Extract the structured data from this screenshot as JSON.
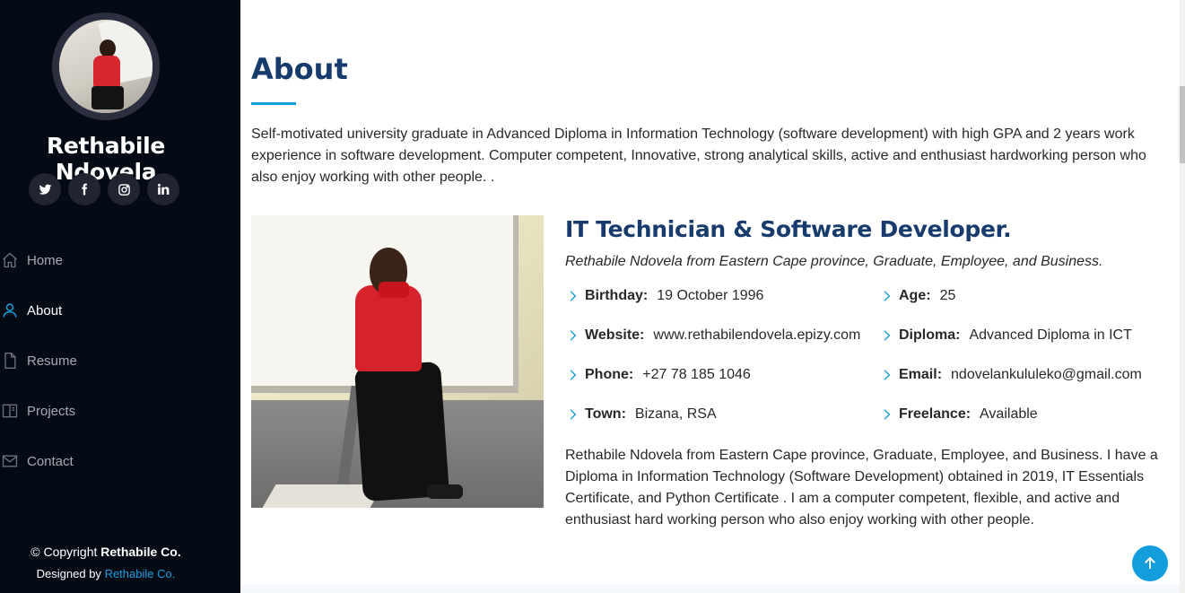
{
  "profile": {
    "name": "Rethabile Ndovela",
    "social": [
      {
        "icon": "twitter-icon",
        "glyph": "t"
      },
      {
        "icon": "facebook-icon",
        "glyph": "f"
      },
      {
        "icon": "instagram-icon",
        "glyph": "◎"
      },
      {
        "icon": "linkedin-icon",
        "glyph": "in"
      }
    ]
  },
  "nav": {
    "items": [
      {
        "label": "Home",
        "icon": "home-icon"
      },
      {
        "label": "About",
        "icon": "user-icon",
        "active": true
      },
      {
        "label": "Resume",
        "icon": "file-icon"
      },
      {
        "label": "Projects",
        "icon": "book-icon"
      },
      {
        "label": "Contact",
        "icon": "envelope-icon"
      }
    ]
  },
  "footer": {
    "copyright_prefix": "© Copyright",
    "copyright_name": "Rethabile Co.",
    "designed_prefix": "Designed by",
    "designed_link": "Rethabile Co."
  },
  "about": {
    "title": "About",
    "intro": "Self-motivated university graduate in Advanced Diploma in Information Technology (software development) with high GPA and 2 years work experience in software development. Computer competent, Innovative, strong analytical skills, active and enthusiast hardworking person who also enjoy working with other people. .",
    "role": "IT Technician & Software Developer.",
    "subtitle": "Rethabile Ndovela from Eastern Cape province, Graduate, Employee, and Business.",
    "facts_left": [
      {
        "label": "Birthday:",
        "value": "19 October 1996"
      },
      {
        "label": "Website:",
        "value": "www.rethabilendovela.epizy.com"
      },
      {
        "label": "Phone:",
        "value": "+27 78 185 1046"
      },
      {
        "label": "Town:",
        "value": "Bizana, RSA"
      }
    ],
    "facts_right": [
      {
        "label": "Age:",
        "value": "25"
      },
      {
        "label": "Diploma:",
        "value": "Advanced Diploma in ICT"
      },
      {
        "label": "Email:",
        "value": "ndovelankululeko@gmail.com"
      },
      {
        "label": "Freelance:",
        "value": "Available"
      }
    ],
    "description": "Rethabile Ndovela from Eastern Cape province, Graduate, Employee, and Business. I have a Diploma in Information Technology (Software Development) obtained in 2019, IT Essentials Certificate, and Python Certificate . I am a computer competent, flexible, and active and enthusiast hard working person who also enjoy working with other people."
  },
  "colors": {
    "sidebar_bg": "#040b14",
    "accent": "#149ddd",
    "heading": "#173b6c"
  }
}
